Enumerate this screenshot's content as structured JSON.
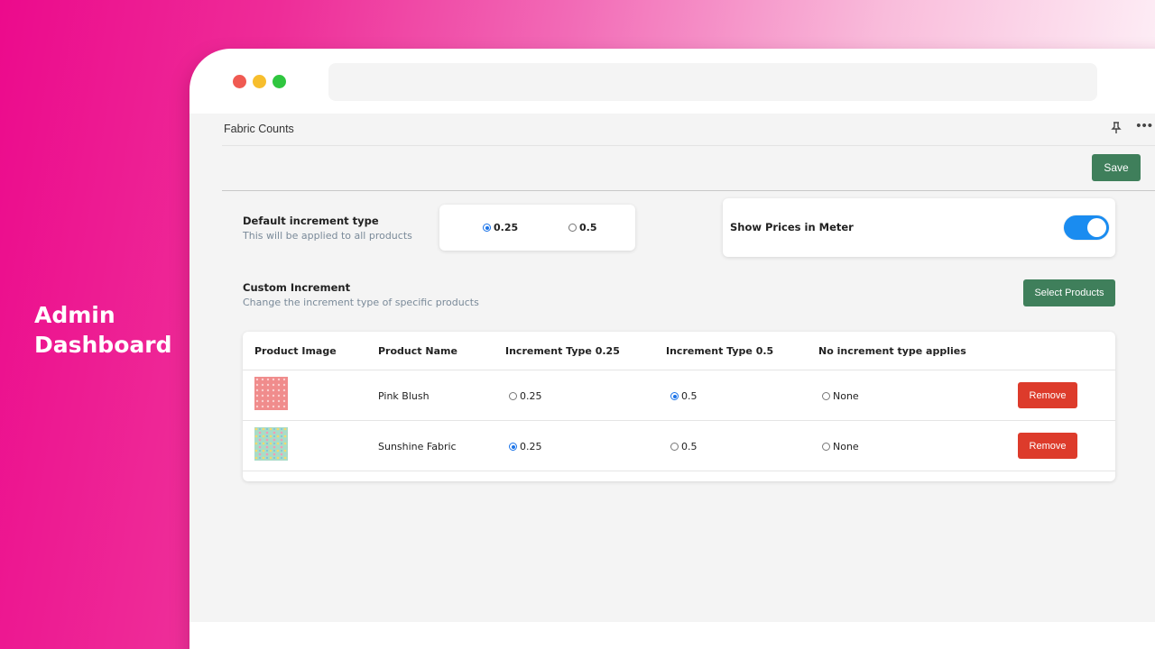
{
  "hero": {
    "line1": "Admin",
    "line2": "Dashboard"
  },
  "app": {
    "title": "Fabric Counts",
    "save_label": "Save"
  },
  "default_increment": {
    "label": "Default increment type",
    "sub": "This will be applied to all products",
    "options": [
      {
        "label": "0.25",
        "selected": true
      },
      {
        "label": "0.5",
        "selected": false
      }
    ]
  },
  "prices": {
    "label": "Show Prices in Meter",
    "enabled": true
  },
  "custom": {
    "label": "Custom Increment",
    "sub": "Change the increment type of specific products",
    "select_label": "Select Products"
  },
  "table": {
    "headers": [
      "Product Image",
      "Product Name",
      "Increment Type 0.25",
      "Increment Type 0.5",
      "No increment type applies"
    ],
    "rows": [
      {
        "name": "Pink Blush",
        "opt1": "0.25",
        "opt2": "0.5",
        "opt3": "None",
        "selected": "0.5",
        "remove": "Remove"
      },
      {
        "name": "Sunshine Fabric",
        "opt1": "0.25",
        "opt2": "0.5",
        "opt3": "None",
        "selected": "0.25",
        "remove": "Remove"
      }
    ]
  },
  "colors": {
    "accent_green": "#3f7f5b",
    "danger_red": "#dd3b2b",
    "toggle_blue": "#1a8cf0",
    "brand_pink": "#ec0a8c"
  }
}
